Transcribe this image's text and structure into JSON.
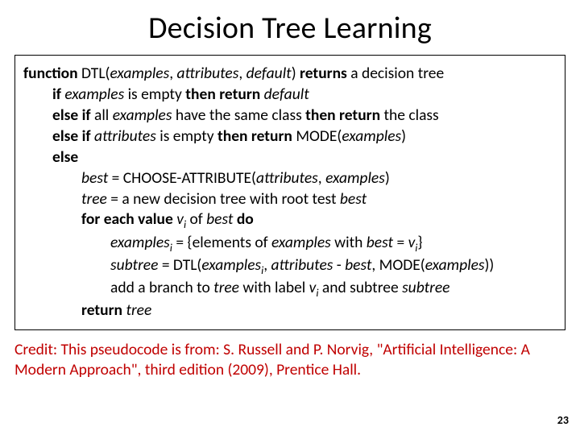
{
  "title": "Decision Tree Learning",
  "page_number": "23",
  "credit": "Credit: This pseudocode is from: S. Russell and P. Norvig, \"Artificial Intelligence: A Modern Approach\", third edition (2009), Prentice Hall.",
  "t": {
    "function": "function",
    "DTL_open": " DTL(",
    "examples": "examples",
    "attributes": "attributes",
    "default": "default",
    "close_returns": ") ",
    "returns": "returns",
    "a_decision_tree": " a decision tree",
    "if": "if",
    "sp": " ",
    "is_empty_then_return": " is empty ",
    "then_return": "then return",
    "else_if_all": "else if",
    "all": " all ",
    "have_same_class": " have the same class ",
    "the_class": " the class",
    "is_empty": " is empty ",
    "MODE_open": " MODE(",
    "close_paren": ")",
    "else": "else",
    "best": "best",
    "eq_choose": " = CHOOSE-ATTRIBUTE(",
    "comma": ", ",
    "tree": "tree",
    "eq_new_tree": " = a new decision tree with root test ",
    "for_each_value": "for each value",
    "v": "v",
    "i": "i",
    "of": " of ",
    "do": "do",
    "eq_set_open": " = {elements of ",
    "with": " with ",
    "eq": " = ",
    "close_brace": "}",
    "subtree": "subtree",
    "eq_DTL": " = DTL(",
    "minus": " - ",
    "comma_MODE": ", MODE(",
    "double_close": "))",
    "add_branch": "add a branch to ",
    "with_label": " with label ",
    "and_subtree": " and subtree ",
    "return": "return"
  }
}
